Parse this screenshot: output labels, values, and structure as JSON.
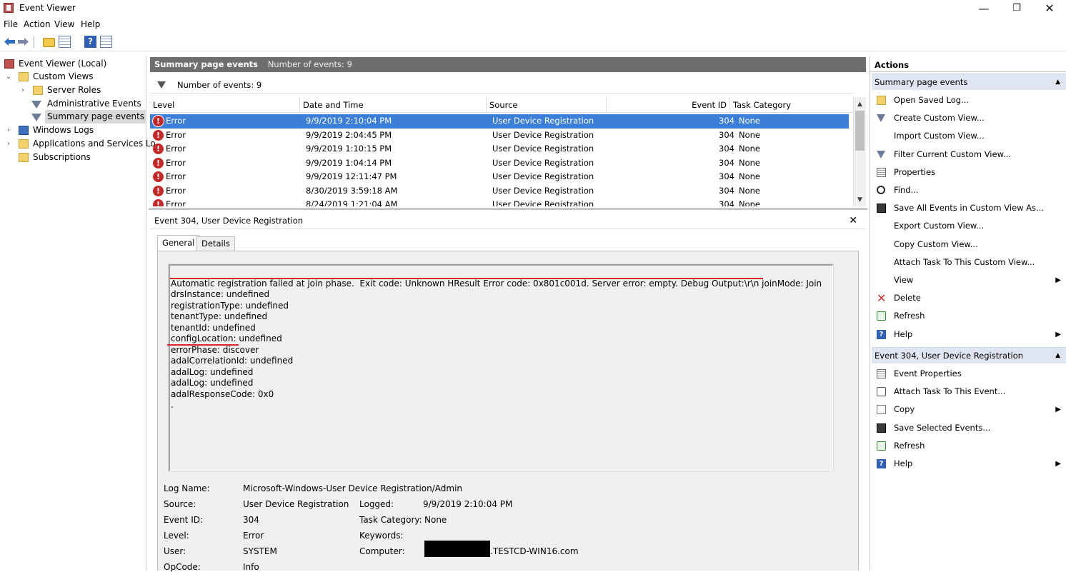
{
  "window": {
    "title": "Event Viewer",
    "min_glyph": "—",
    "max_glyph": "❐",
    "close_glyph": "✕"
  },
  "menu": [
    "File",
    "Action",
    "View",
    "Help"
  ],
  "tree": {
    "root": "Event Viewer (Local)",
    "custom_views": "Custom Views",
    "server_roles": "Server Roles",
    "administrative_events": "Administrative Events",
    "summary_page_events": "Summary page events",
    "windows_logs": "Windows Logs",
    "applications_services": "Applications and Services Lo",
    "subscriptions": "Subscriptions"
  },
  "summary": {
    "title": "Summary page events",
    "count_text": "Number of events: 9",
    "filter_text": "Number of events: 9"
  },
  "grid": {
    "columns": [
      "Level",
      "Date and Time",
      "Source",
      "Event ID",
      "Task Category"
    ],
    "rows": [
      {
        "level": "Error",
        "date": "9/9/2019 2:10:04 PM",
        "source": "User Device Registration",
        "id": "304",
        "category": "None"
      },
      {
        "level": "Error",
        "date": "9/9/2019 2:04:45 PM",
        "source": "User Device Registration",
        "id": "304",
        "category": "None"
      },
      {
        "level": "Error",
        "date": "9/9/2019 1:10:15 PM",
        "source": "User Device Registration",
        "id": "304",
        "category": "None"
      },
      {
        "level": "Error",
        "date": "9/9/2019 1:04:14 PM",
        "source": "User Device Registration",
        "id": "304",
        "category": "None"
      },
      {
        "level": "Error",
        "date": "9/9/2019 12:11:47 PM",
        "source": "User Device Registration",
        "id": "304",
        "category": "None"
      },
      {
        "level": "Error",
        "date": "8/30/2019 3:59:18 AM",
        "source": "User Device Registration",
        "id": "304",
        "category": "None"
      },
      {
        "level": "Error",
        "date": "8/24/2019 1:21:04 AM",
        "source": "User Device Registration",
        "id": "304",
        "category": "None"
      }
    ]
  },
  "detail": {
    "header": "Event 304, User Device Registration",
    "close_glyph": "✕",
    "tab_general": "General",
    "tab_details": "Details",
    "message_lines": [
      "Automatic registration failed at join phase.  Exit code: Unknown HResult Error code: 0x801c001d. Server error: empty. Debug Output:\\r\\n joinMode: Join",
      "drsInstance: undefined",
      "registrationType: undefined",
      "tenantType: undefined",
      "tenantId: undefined",
      "configLocation: undefined",
      "errorPhase: discover",
      "adalCorrelationId: undefined",
      "adalLog: undefined",
      "adalLog: undefined",
      "adalResponseCode: 0x0",
      "."
    ],
    "props": {
      "log_name_label": "Log Name:",
      "log_name_value": "Microsoft-Windows-User Device Registration/Admin",
      "source_label": "Source:",
      "source_value": "User Device Registration",
      "logged_label": "Logged:",
      "logged_value": "9/9/2019 2:10:04 PM",
      "event_id_label": "Event ID:",
      "event_id_value": "304",
      "task_category_label": "Task Category:",
      "task_category_value": "None",
      "level_label": "Level:",
      "level_value": "Error",
      "keywords_label": "Keywords:",
      "keywords_value": "",
      "user_label": "User:",
      "user_value": "SYSTEM",
      "computer_label": "Computer:",
      "computer_value": ".TESTCD-WIN16.com",
      "opcode_label": "OpCode:",
      "opcode_value": "Info"
    }
  },
  "actions": {
    "title": "Actions",
    "group1": "Summary page events",
    "group1_items": [
      {
        "label": "Open Saved Log...",
        "icon": "folder-open-icon",
        "submenu": false
      },
      {
        "label": "Create Custom View...",
        "icon": "filter-icon",
        "submenu": false
      },
      {
        "label": "Import Custom View...",
        "icon": "",
        "submenu": false
      },
      {
        "label": "Filter Current Custom View...",
        "icon": "filter-icon",
        "submenu": false
      },
      {
        "label": "Properties",
        "icon": "properties-icon",
        "submenu": false
      },
      {
        "label": "Find...",
        "icon": "find-icon",
        "submenu": false
      },
      {
        "label": "Save All Events in Custom View As...",
        "icon": "save-icon",
        "submenu": false
      },
      {
        "label": "Export Custom View...",
        "icon": "",
        "submenu": false
      },
      {
        "label": "Copy Custom View...",
        "icon": "",
        "submenu": false
      },
      {
        "label": "Attach Task To This Custom View...",
        "icon": "",
        "submenu": false
      },
      {
        "label": "View",
        "icon": "",
        "submenu": true
      },
      {
        "label": "Delete",
        "icon": "delete-icon",
        "submenu": false
      },
      {
        "label": "Refresh",
        "icon": "refresh-icon",
        "submenu": false
      },
      {
        "label": "Help",
        "icon": "help-icon",
        "submenu": true
      }
    ],
    "group2": "Event 304, User Device Registration",
    "group2_items": [
      {
        "label": "Event Properties",
        "icon": "properties-icon",
        "submenu": false
      },
      {
        "label": "Attach Task To This Event...",
        "icon": "task-icon",
        "submenu": false
      },
      {
        "label": "Copy",
        "icon": "copy-icon",
        "submenu": true
      },
      {
        "label": "Save Selected Events...",
        "icon": "save-icon",
        "submenu": false
      },
      {
        "label": "Refresh",
        "icon": "refresh-icon",
        "submenu": false
      },
      {
        "label": "Help",
        "icon": "help-icon",
        "submenu": true
      }
    ]
  }
}
